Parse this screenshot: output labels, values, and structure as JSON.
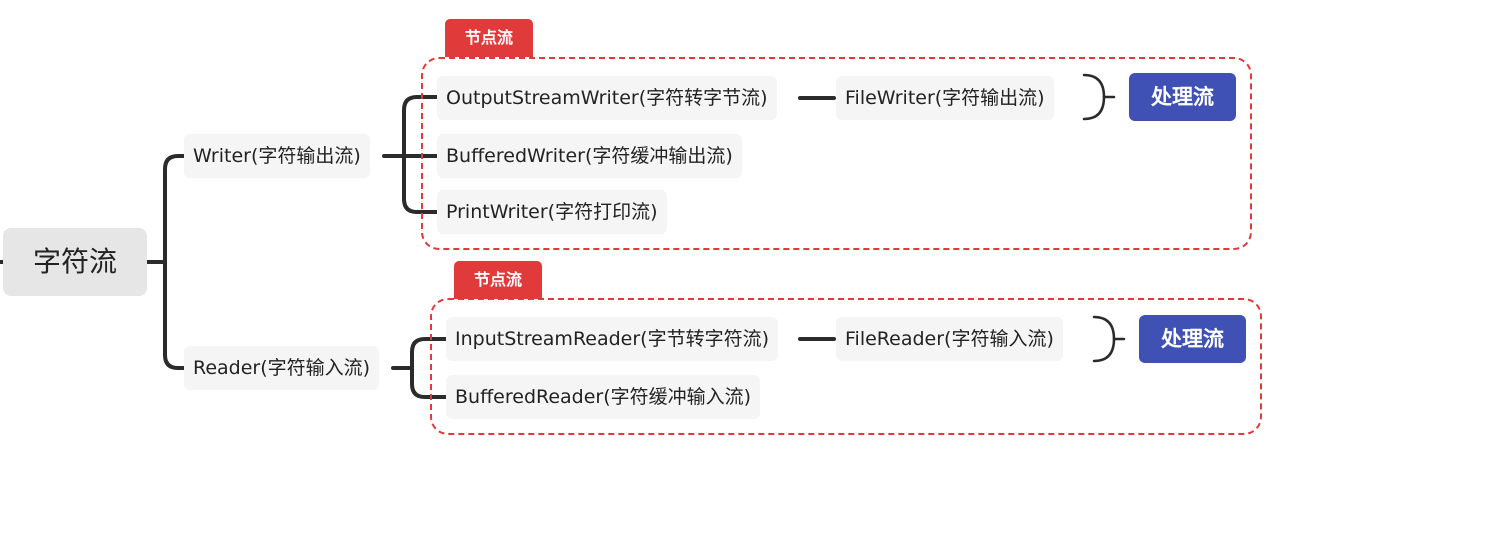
{
  "root": {
    "label": "字符流"
  },
  "branches": {
    "writer": {
      "label": "Writer(字符输出流)",
      "group_tag": "节点流",
      "children": [
        {
          "label": "OutputStreamWriter(字符转字节流)",
          "sub": "FileWriter(字符输出流)",
          "handler": "处理流"
        },
        {
          "label": "BufferedWriter(字符缓冲输出流)"
        },
        {
          "label": "PrintWriter(字符打印流)"
        }
      ]
    },
    "reader": {
      "label": "Reader(字符输入流)",
      "group_tag": "节点流",
      "children": [
        {
          "label": "InputStreamReader(字节转字符流)",
          "sub": "FileReader(字符输入流)",
          "handler": "处理流"
        },
        {
          "label": "BufferedReader(字符缓冲输入流)"
        }
      ]
    }
  },
  "colors": {
    "connector": "#2b2b2b",
    "node_bg": "#f5f5f5",
    "root_bg": "#e6e6e6",
    "tag_bg": "#e03a3a",
    "dashed_border": "#e03a3a",
    "handler_bg": "#3f51b5"
  }
}
